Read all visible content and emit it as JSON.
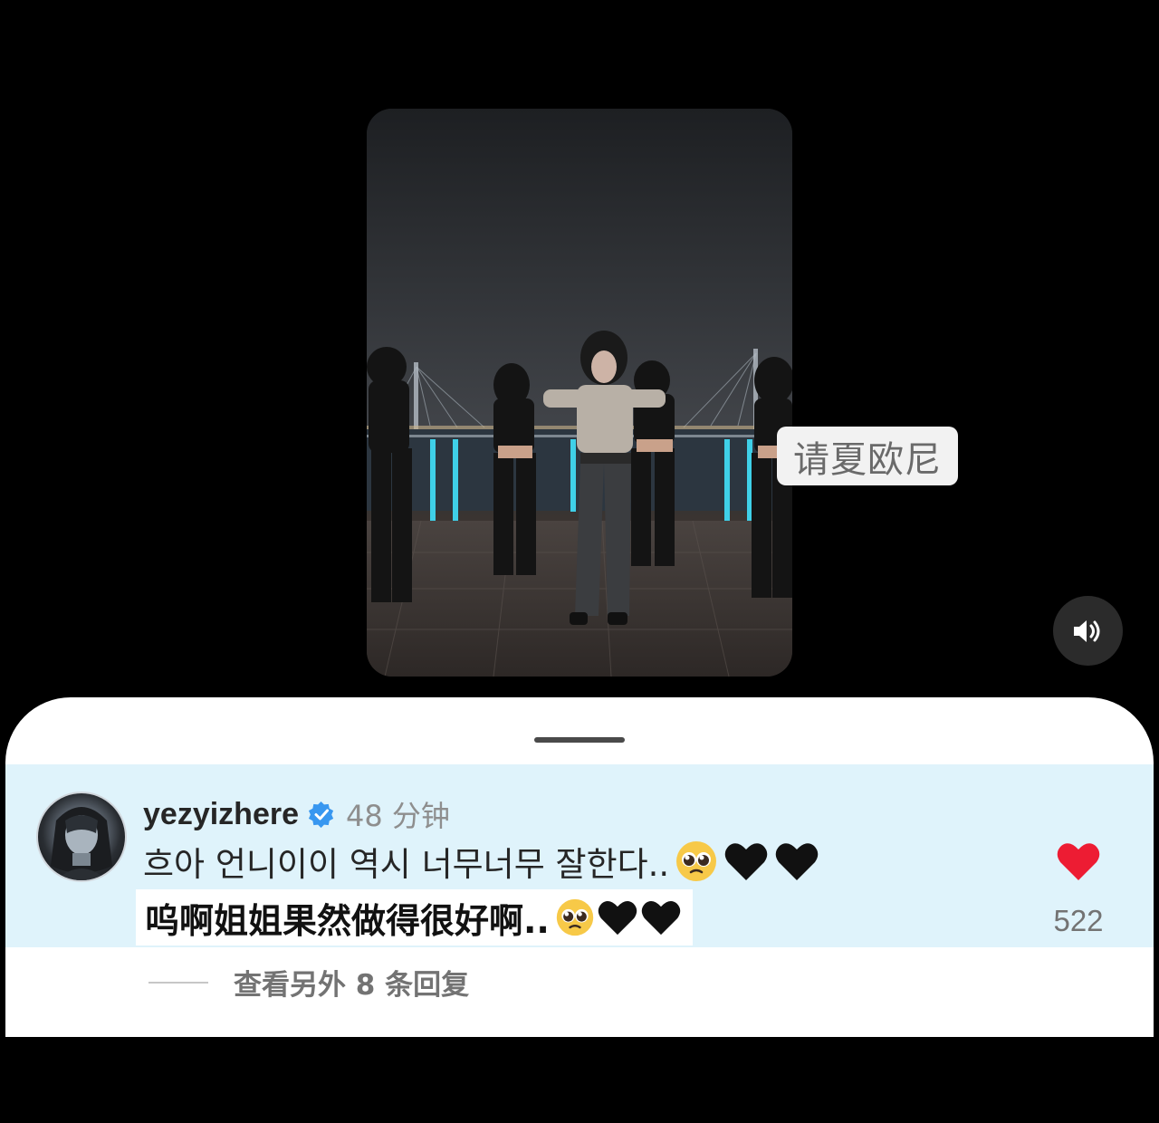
{
  "video": {
    "translation_tooltip": "请夏欧尼"
  },
  "controls": {
    "volume_icon": "speaker-on-icon"
  },
  "comment": {
    "username": "yezyizhere",
    "verified_icon": "verified-badge-icon",
    "time": "48 分钟",
    "text": "흐아 언니이이 역시 너무너무 잘한다..",
    "text_emojis": [
      "pleading-face-emoji",
      "black-heart-emoji",
      "black-heart-emoji"
    ],
    "translation": "呜啊姐姐果然做得很好啊..",
    "translation_emojis": [
      "pleading-face-emoji",
      "black-heart-emoji",
      "black-heart-emoji"
    ],
    "like_icon": "heart-filled-icon",
    "like_count": "522",
    "like_color": "#ed1c33",
    "highlight_color": "#dff3fb"
  },
  "replies": {
    "label": "查看另外 8 条回复"
  }
}
